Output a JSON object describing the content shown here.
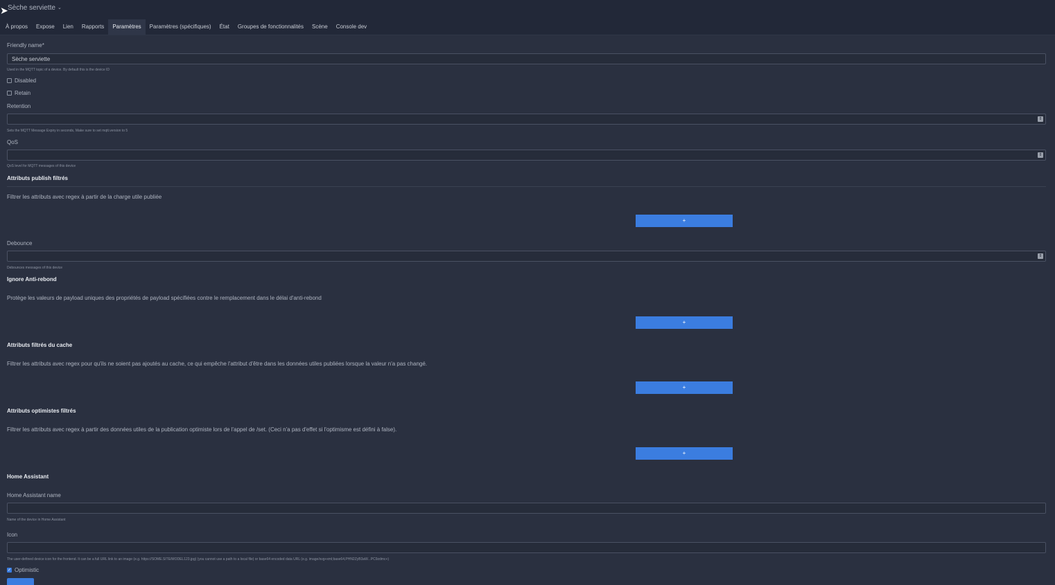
{
  "header": {
    "device_name": "Sèche serviette",
    "caret": "⌄"
  },
  "tabs": [
    "À propos",
    "Expose",
    "Lien",
    "Rapports",
    "Paramètres",
    "Paramètres (spécifiques)",
    "État",
    "Groupes de fonctionnalités",
    "Scène",
    "Console dev"
  ],
  "active_tab": 4,
  "form": {
    "friendly_name": {
      "label": "Friendly name*",
      "value": "Sèche serviette",
      "help": "Used in the MQTT topic of a device. By default this is the device ID"
    },
    "disabled": {
      "label": "Disabled",
      "checked": false
    },
    "retain": {
      "label": "Retain",
      "checked": false
    },
    "retention": {
      "label": "Retention",
      "value": "",
      "help": "Sets the MQTT Message Expiry in seconds, Make sure to set mqtt.version to 5"
    },
    "qos": {
      "label": "QoS",
      "value": "",
      "help": "QoS level for MQTT messages of this device"
    },
    "filtered_publish": {
      "title": "Attributs publish filtrés",
      "desc": "Filtrer les attributs avec regex à partir de la charge utile publiée",
      "add": "+"
    },
    "debounce": {
      "label": "Debounce",
      "value": "",
      "help": "Debounces messages of this device"
    },
    "debounce_ignore": {
      "title": "Ignore Anti-rebond",
      "desc": "Protège les valeurs de payload uniques des propriétés de payload spécifiées contre le remplacement dans le délai d'anti-rebond",
      "add": "+"
    },
    "filtered_cache": {
      "title": "Attributs filtrés du cache",
      "desc": "Filtrer les attributs avec regex pour qu'ils ne soient pas ajoutés au cache, ce qui empêche l'attribut d'être dans les données utiles publiées lorsque la valeur n'a pas changé.",
      "add": "+"
    },
    "filtered_optimistic": {
      "title": "Attributs optimistes filtrés",
      "desc": "Filtrer les attributs avec regex à partir des données utiles de la publication optimiste lors de l'appel de /set. (Ceci n'a pas d'effet si l'optimisme est défini à false).",
      "add": "+"
    },
    "home_assistant": {
      "title": "Home Assistant"
    },
    "ha_name": {
      "label": "Home Assistant name",
      "value": "",
      "help": "Name of the device in Home Assistant"
    },
    "icon": {
      "label": "Icon",
      "value": "",
      "help": "The user-defined device icon for the frontend. It can be a full URL link to an image (e.g. https://SOME.SITE/MODEL123.jpg) (you cannot use a path to a local file) or base64 encoded data URL (e.g. image/svg+xml;base64,PHN2ZyB3aW...PC9zdmc+)"
    },
    "optimistic": {
      "label": "Optimistic",
      "checked": true
    }
  },
  "colors": {
    "accent": "#3b7de0",
    "background": "#2a3040",
    "topbar": "#222838"
  }
}
